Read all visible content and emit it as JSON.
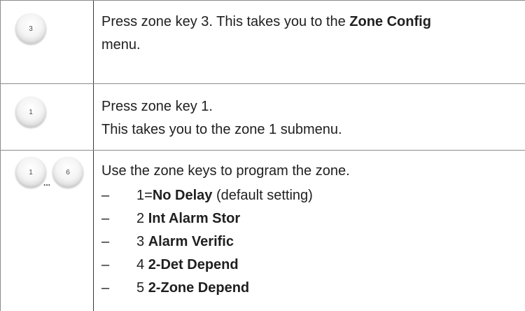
{
  "steps": [
    {
      "key": "3",
      "text_before": "Press zone key 3. This takes you to the ",
      "text_bold": "Zone Config",
      "text_after": "menu."
    },
    {
      "key": "1",
      "line1": "Press zone key 1.",
      "line2": "This takes you to the zone 1 submenu."
    },
    {
      "key_start": "1",
      "key_sep": "...",
      "key_end": "6",
      "intro": "Use the zone keys to program the zone.",
      "options": [
        {
          "dash": "–",
          "num": "1=",
          "label": "No Delay",
          "note": " (default setting)"
        },
        {
          "dash": "–",
          "num": "2 ",
          "label": "Int Alarm Stor",
          "note": ""
        },
        {
          "dash": "–",
          "num": "3 ",
          "label": "Alarm Verific",
          "note": ""
        },
        {
          "dash": "–",
          "num": "4 ",
          "label": "2-Det Depend",
          "note": ""
        },
        {
          "dash": "–",
          "num": "5 ",
          "label": "2-Zone Depend",
          "note": ""
        }
      ]
    }
  ]
}
